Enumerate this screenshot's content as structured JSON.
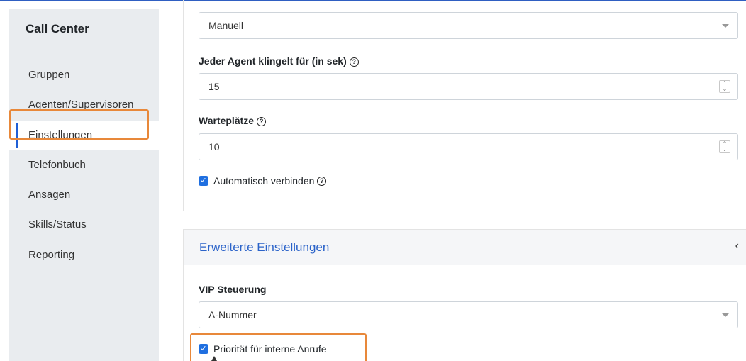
{
  "sidebar": {
    "title": "Call Center",
    "items": [
      {
        "label": "Gruppen"
      },
      {
        "label": "Agenten/Supervisoren"
      },
      {
        "label": "Einstellungen",
        "active": true
      },
      {
        "label": "Telefonbuch"
      },
      {
        "label": "Ansagen"
      },
      {
        "label": "Skills/Status"
      },
      {
        "label": "Reporting"
      }
    ]
  },
  "settings": {
    "mode_select": {
      "value": "Manuell"
    },
    "ring_time": {
      "label": "Jeder Agent klingelt für (in sek)",
      "value": "15"
    },
    "queue_slots": {
      "label": "Warteplätze",
      "value": "10"
    },
    "auto_connect": {
      "label": "Automatisch verbinden",
      "checked": true
    }
  },
  "advanced": {
    "title": "Erweiterte Einstellungen",
    "chevron": "‹",
    "vip": {
      "label": "VIP Steuerung",
      "value": "A-Nummer"
    },
    "internal_priority": {
      "label": "Priorität für interne Anrufe",
      "checked": true
    }
  },
  "icons": {
    "help": "?",
    "check": "✓",
    "spin": "⌃⌄"
  },
  "colors": {
    "accent": "#1f5fd6",
    "highlight": "#e8883a",
    "link": "#2b63c9"
  }
}
